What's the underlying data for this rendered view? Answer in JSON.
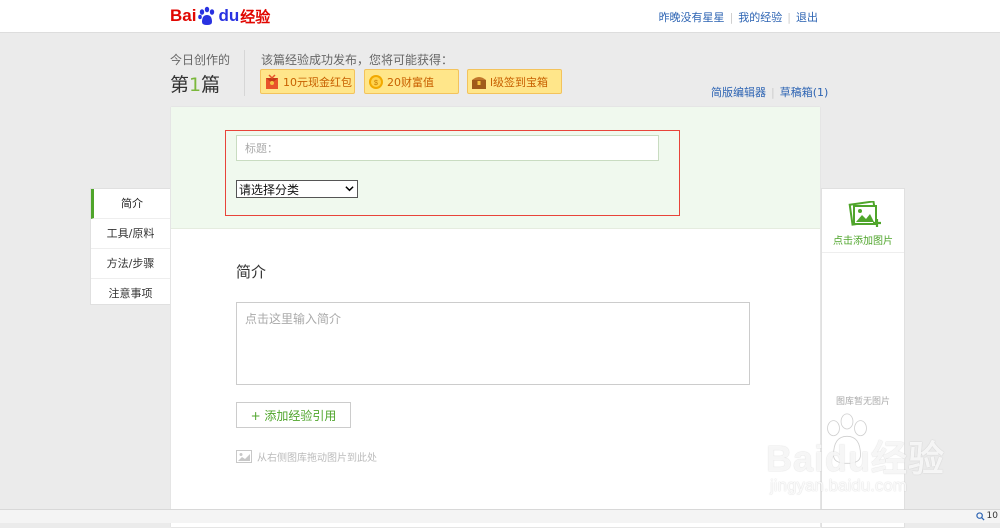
{
  "header": {
    "logo": {
      "left": "Bai",
      "right": "du",
      "suffix": "经验",
      "icon": "baidu-paw-icon"
    },
    "links": [
      "昨晚没有星星",
      "我的经验",
      "退出"
    ]
  },
  "today": {
    "label": "今日创作的",
    "prefix": "第",
    "number": "1",
    "suffix": "篇"
  },
  "rewards": {
    "title": "该篇经验成功发布，您将可能获得：",
    "items": [
      {
        "label": "10元现金红包",
        "icon": "red-envelope-icon"
      },
      {
        "label": "20财富值",
        "icon": "coin-icon"
      },
      {
        "label": "l级签到宝箱",
        "icon": "treasure-chest-icon"
      }
    ]
  },
  "editor_links": {
    "simple": "简版编辑器",
    "draft": "草稿箱(1)"
  },
  "form": {
    "title_placeholder": "标题：",
    "category_selected": "请选择分类",
    "intro_heading": "简介",
    "intro_placeholder": "点击这里输入简介",
    "add_reference": "+ 添加经验引用",
    "drag_hint": "从右侧图库拖动图片到此处"
  },
  "left_nav": {
    "items": [
      "简介",
      "工具/原料",
      "方法/步骤",
      "注意事项"
    ],
    "active_index": 0
  },
  "gallery": {
    "add_label": "点击添加图片",
    "empty_text": "图库暂无图片"
  },
  "watermark": {
    "brand": "Baidu经验",
    "url": "jingyan.baidu.com"
  },
  "status": {
    "zoom": "10"
  },
  "colors": {
    "brand_red": "#e10601",
    "brand_blue": "#2932e1",
    "accent_green": "#4fa52b",
    "link_blue": "#2d64b3",
    "highlight_red": "#e8443a"
  }
}
